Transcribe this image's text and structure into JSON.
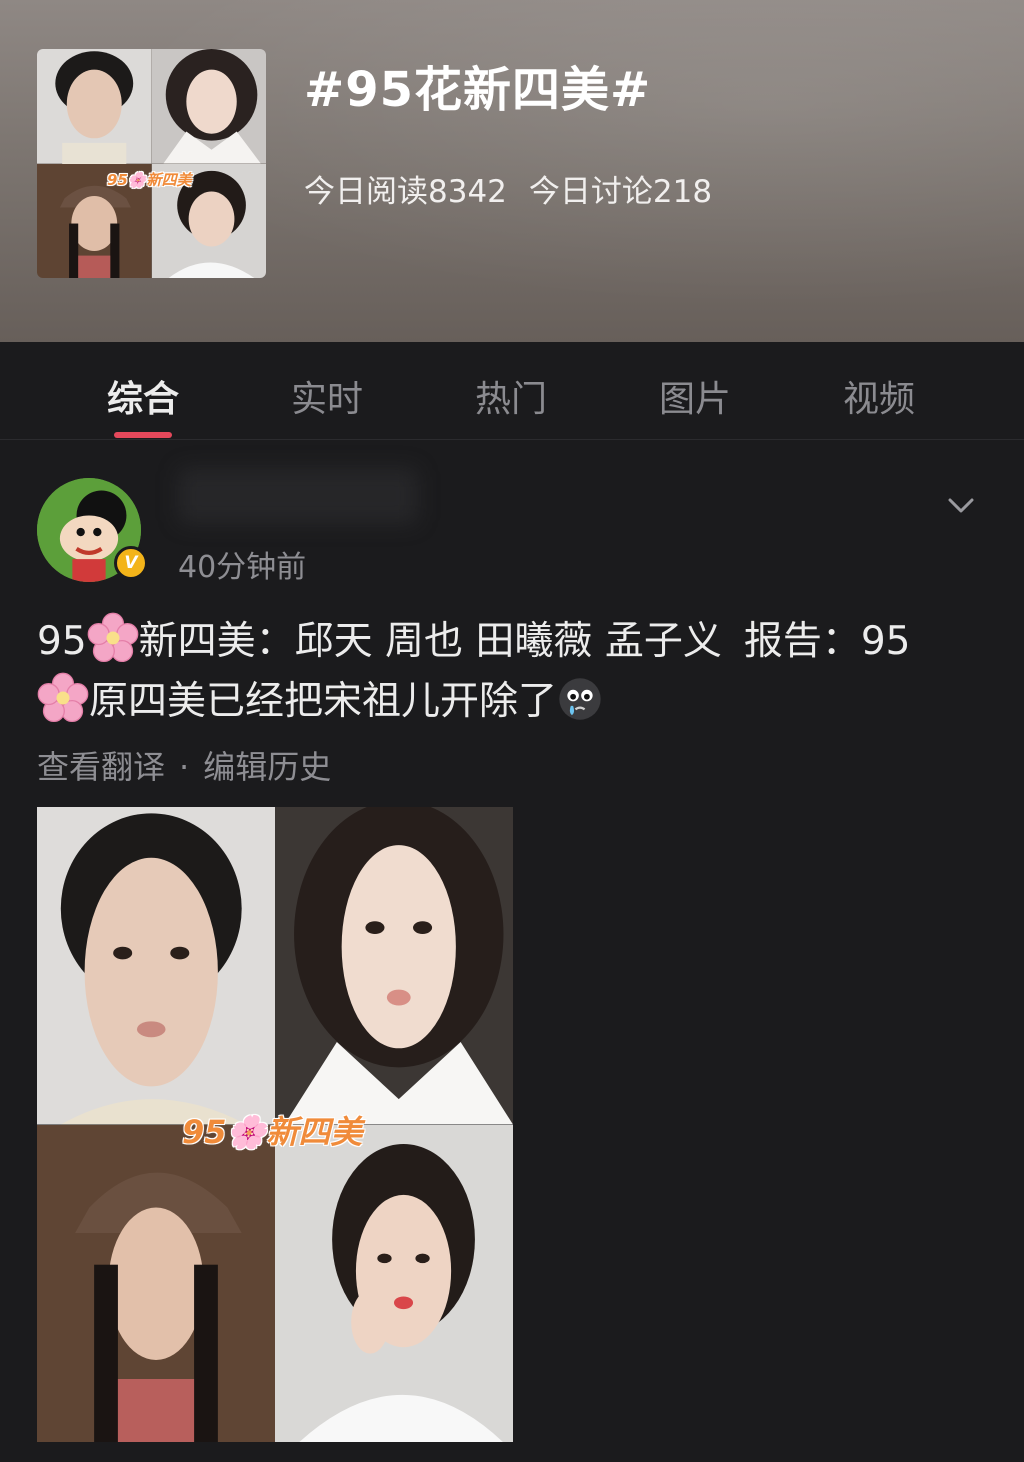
{
  "topic": {
    "title": "#95花新四美#",
    "reads_today": "今日阅读8342",
    "discussions_today": "今日讨论218",
    "cover_caption": "95🌸新四美"
  },
  "tabs": [
    {
      "label": "综合",
      "active": true
    },
    {
      "label": "实时",
      "active": false
    },
    {
      "label": "热门",
      "active": false
    },
    {
      "label": "图片",
      "active": false
    },
    {
      "label": "视频",
      "active": false
    }
  ],
  "post": {
    "time": "40分钟前",
    "text_line1_a": "95",
    "text_line1_b": "新四美：邱天 周也 田曦薇 孟子义",
    "text_line1_c": "报告：95",
    "text_line2": "原四美已经把宋祖儿开除了",
    "link_translate": "查看翻译",
    "link_separator": "·",
    "link_history": "编辑历史",
    "image_caption": "95🌸新四美",
    "verified_icon_text": "V"
  },
  "colors": {
    "accent": "#e5485b",
    "background": "#1b1b1d",
    "verified": "#f3b41a",
    "caption": "#f08b3a"
  },
  "icons": [
    "cherry-blossom-icon",
    "crying-face-icon",
    "chevron-down-icon",
    "verified-badge-icon"
  ]
}
